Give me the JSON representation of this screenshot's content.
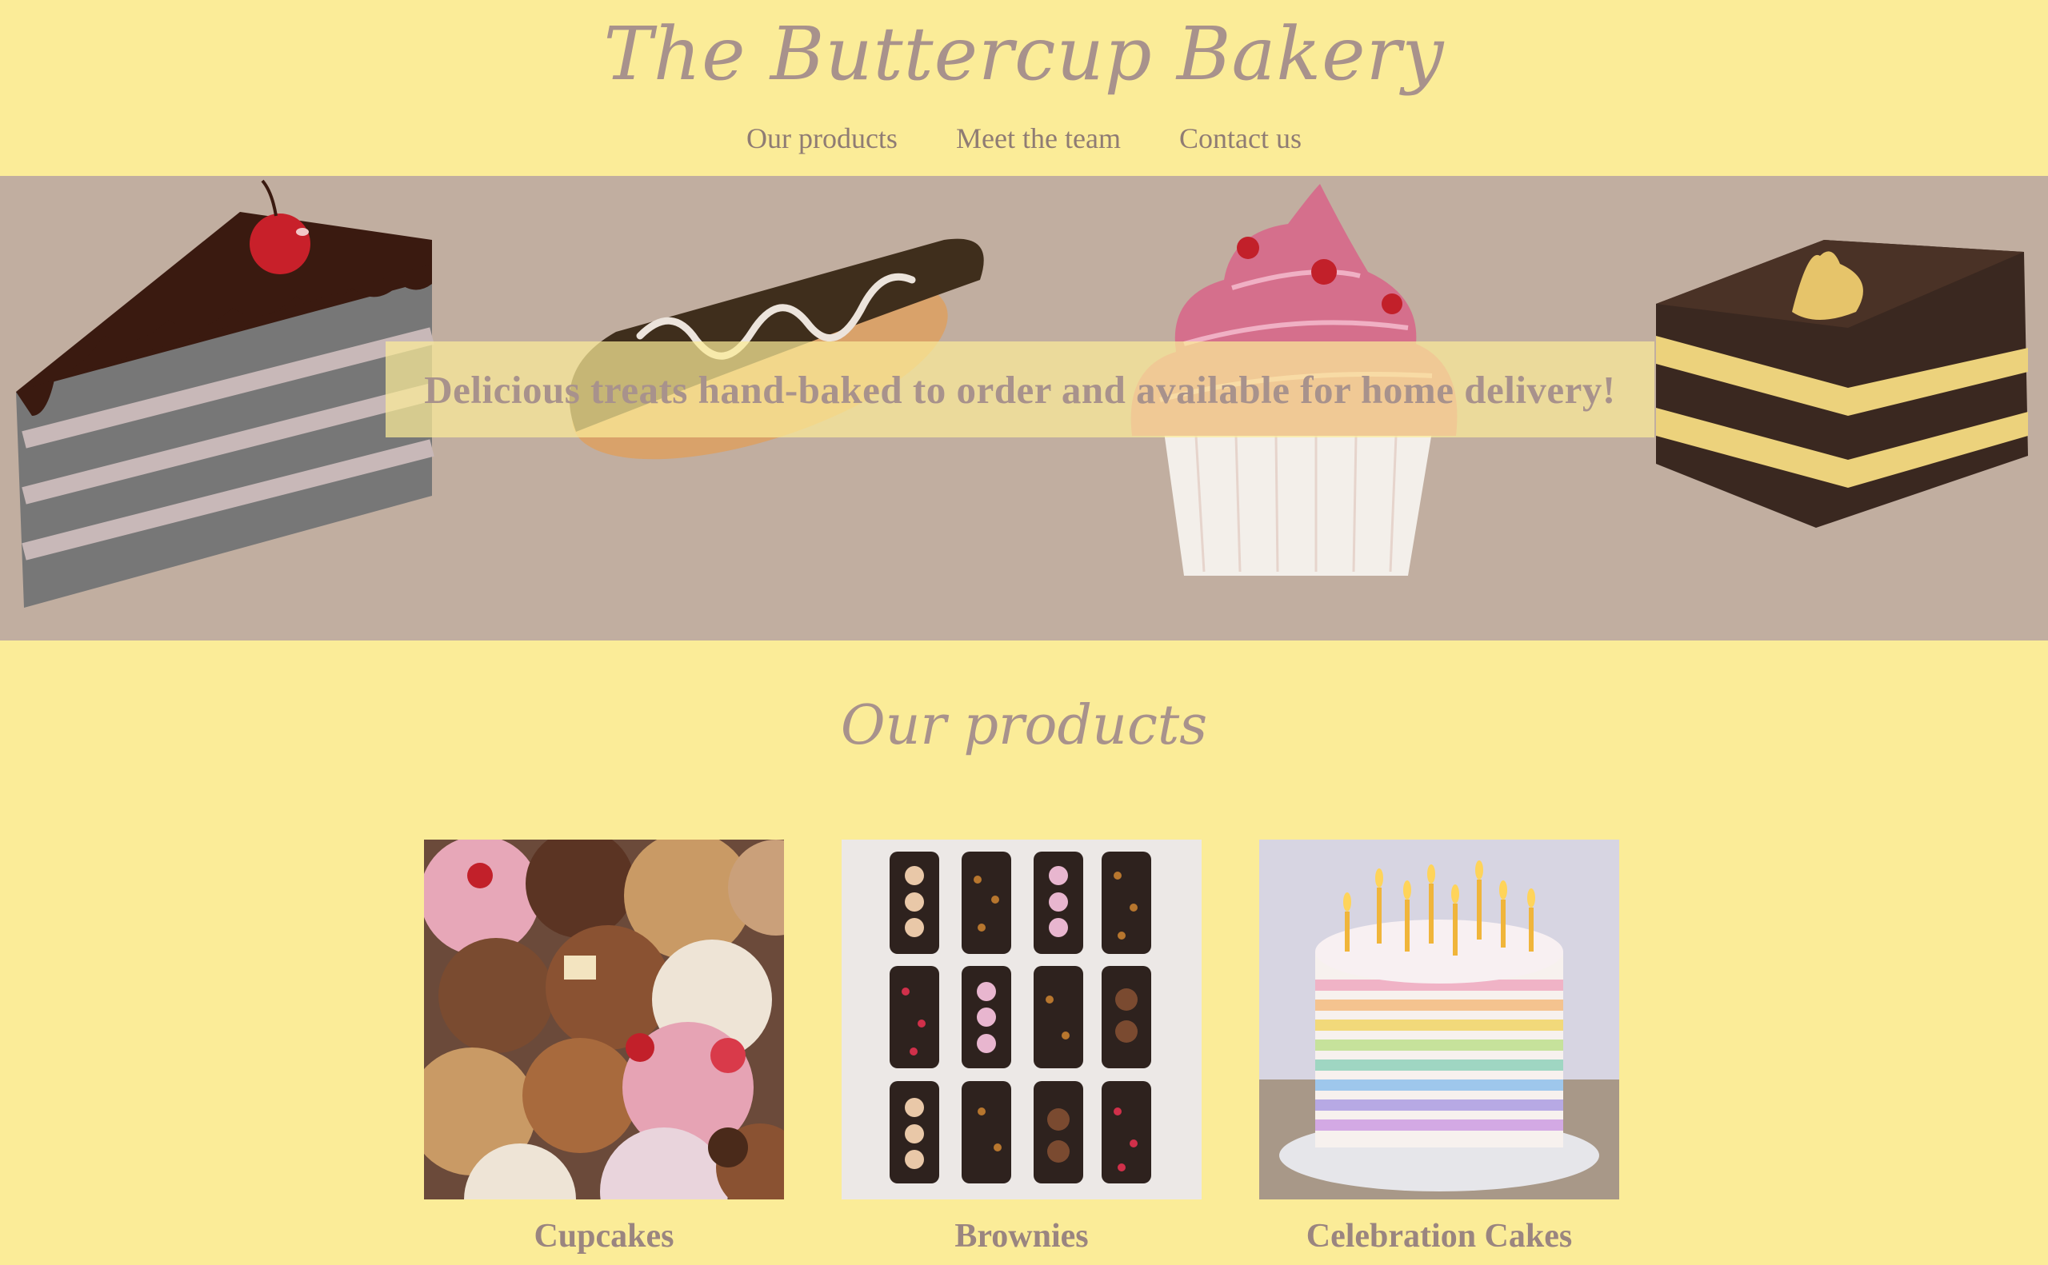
{
  "site": {
    "title": "The Buttercup Bakery"
  },
  "nav": {
    "items": [
      {
        "label": "Our products"
      },
      {
        "label": "Meet the team"
      },
      {
        "label": "Contact us"
      }
    ]
  },
  "hero": {
    "tagline": "Delicious treats hand-baked to order and available for home delivery!",
    "illustrations": [
      "cake-slice-with-cherry",
      "eclair",
      "cupcake",
      "chocolate-layer-cake"
    ]
  },
  "products": {
    "heading": "Our products",
    "items": [
      {
        "name": "Cupcakes",
        "image": "cupcakes-photo"
      },
      {
        "name": "Brownies",
        "image": "brownies-photo"
      },
      {
        "name": "Celebration Cakes",
        "image": "celebration-cake-photo"
      }
    ]
  },
  "colors": {
    "page_background": "#fbec98",
    "hero_background": "#c1aea0",
    "text": "#a8928c"
  }
}
